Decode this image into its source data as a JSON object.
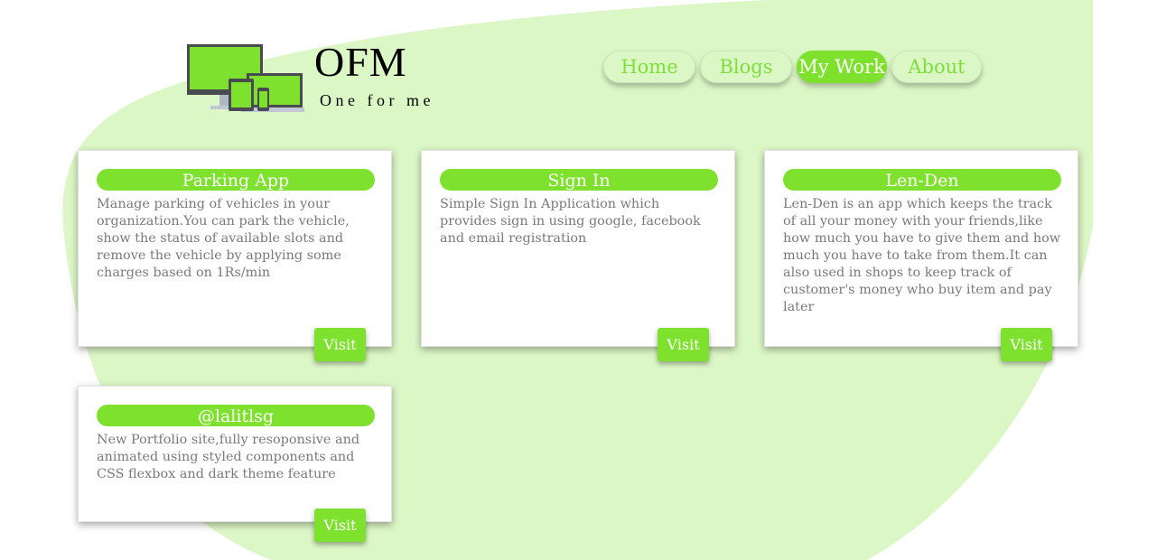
{
  "brand": {
    "title": "OFM",
    "tagline": "One for me"
  },
  "nav": {
    "items": [
      {
        "label": "Home",
        "active": false
      },
      {
        "label": "Blogs",
        "active": false
      },
      {
        "label": "My Work",
        "active": true
      },
      {
        "label": "About",
        "active": false
      }
    ]
  },
  "projects": [
    {
      "title": "Parking App",
      "description": "Manage parking of vehicles in your organization.You can park the vehicle, show the status of available slots and remove the vehicle by applying some charges based on 1Rs/min",
      "button": "Visit"
    },
    {
      "title": "Sign In",
      "description": "Simple Sign In Application which provides sign in using google, facebook and email registration",
      "button": "Visit"
    },
    {
      "title": "Len-Den",
      "description": "Len-Den is an app which keeps the track of all your money with your friends,like how much you have to give them and how much you have to take from them.It can also used in shops to keep track of customer's money who buy item and pay later",
      "button": "Visit"
    },
    {
      "title": "@lalitlsg",
      "description": "New Portfolio site,fully resoponsive and animated using styled components and CSS flexbox and dark theme feature",
      "button": "Visit"
    }
  ],
  "colors": {
    "accent": "#7ee12d",
    "background_blob": "#dcf7c6",
    "card_text": "#7a7a7a",
    "nav_inactive_text": "#7de03a"
  },
  "icons": {
    "logo": "devices-icon"
  }
}
